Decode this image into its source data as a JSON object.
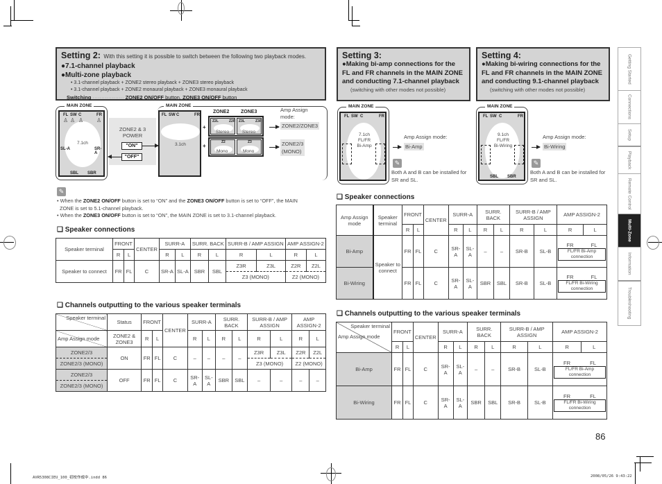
{
  "setting2": {
    "title": "Setting 2:",
    "description": "With this setting it is possible to switch between the following two playback modes.",
    "bullets": [
      "●7.1-channel playback",
      "●Multi-zone playback"
    ],
    "sub_items": [
      "• 3.1-channel playback + ZONE2 stereo playback + ZONE3 stereo playback",
      "• 3.1-channel playback + ZONE2 monaural playback + ZONE3 monaural playback"
    ],
    "switching_label": "Switching",
    "switching_dots": "··················",
    "switching_b1": "ZONE2 ON/OFF",
    "switching_t1": " button, ",
    "switching_b2": "ZONE3 ON/OFF",
    "switching_t2": " button",
    "diagram": {
      "main_zone": "MAIN ZONE",
      "mode_71": "7.1ch",
      "mode_31": "3.1ch",
      "power_label_1": "ZONE2 & 3",
      "power_label_2": "POWER",
      "on_label": "\"ON\"",
      "off_label": "\"OFF\"",
      "zone2": "ZONE2",
      "zone3": "ZONE3",
      "stereo": "Stereo",
      "mono": "Mono",
      "plus": "+",
      "amp_assign_label_1": "Amp Assign",
      "amp_assign_label_2": "mode:",
      "amp_zone23": "ZONE2/ZONE3",
      "amp_zone23_mono_1": "ZONE2/3",
      "amp_zone23_mono_2": "(MONO)",
      "speakers": {
        "fl": "FL",
        "sw": "SW",
        "c": "C",
        "fr": "FR",
        "sla": "SL-A",
        "sra": "SR-A",
        "sbl": "SBL",
        "sbr": "SBR",
        "z2l": "Z2L",
        "z2r": "Z2R",
        "z3l": "Z3L",
        "z3r": "Z3R",
        "z2": "Z2",
        "z3": "Z3"
      }
    },
    "notes": {
      "n1_a": "• When the ",
      "n1_b1": "ZONE2 ON/OFF",
      "n1_c": " button is set to “ON” and the ",
      "n1_b2": "ZONE3 ON/OFF",
      "n1_d": " button is set to “OFF”, the MAIN",
      "n1_e": "ZONE is set to 5.1-channel playback.",
      "n2_a": "• When the ",
      "n2_b": "ZONE3 ON/OFF",
      "n2_c": " button is set to “ON”, the MAIN ZONE is set to 3.1-channel playback."
    },
    "speaker_connections": {
      "title": "❑ Speaker connections",
      "headers": [
        "Speaker terminal",
        "FRONT",
        "CENTER",
        "SURR-A",
        "SURR. BACK",
        "SURR-B / AMP ASSIGN",
        "AMP ASSIGN-2"
      ],
      "rl": [
        "R",
        "L"
      ],
      "row_label": "Speaker to connect",
      "row": [
        "FR",
        "FL",
        "C",
        "SR-A",
        "SL-A",
        "SBR",
        "SBL",
        "Z3R",
        "Z3L",
        "Z2R",
        "Z2L"
      ],
      "mono": [
        "Z3 (MONO)",
        "Z2 (MONO)"
      ]
    },
    "channels": {
      "title": "❑ Channels outputting to the various speaker terminals",
      "corner_top": "Speaker terminal",
      "corner_bottom": "Amp Assign mode",
      "status": "Status",
      "status_sub": "ZONE2 & ZONE3",
      "headers": [
        "FRONT",
        "CENTER",
        "SURR-A",
        "SURR. BACK",
        "SURR-B / AMP ASSIGN",
        "AMP ASSIGN-2"
      ],
      "rows": [
        {
          "modes": [
            "ZONE2/3",
            "ZONE2/3 (MONO)"
          ],
          "status": "ON",
          "front": [
            "FR",
            "FL"
          ],
          "center": "C",
          "surra": [
            "–",
            "–"
          ],
          "surrback": [
            "–",
            "–"
          ],
          "surrb": [
            "Z3R",
            "Z3L"
          ],
          "amp2": [
            "Z2R",
            "Z2L"
          ],
          "mono": [
            "Z3 (MONO)",
            "Z2 (MONO)"
          ]
        },
        {
          "modes": [
            "ZONE2/3",
            "ZONE2/3 (MONO)"
          ],
          "status": "OFF",
          "front": [
            "FR",
            "FL"
          ],
          "center": "C",
          "surra": [
            "SR-A",
            "SL-A"
          ],
          "surrback": [
            "SBR",
            "SBL"
          ],
          "surrb": [
            "–",
            "–"
          ],
          "amp2": [
            "–",
            "–"
          ]
        }
      ]
    }
  },
  "setting3": {
    "title": "Setting 3:",
    "bullet": "●Making bi-amp connections for the FL and FR channels in the MAIN ZONE and conducting 7.1-channel playback",
    "note": "(switching with other modes not possible)",
    "diagram": {
      "main_zone": "MAIN ZONE",
      "mode_1": "7.1ch",
      "mode_2": "FL/FR",
      "mode_3": "Bi-Amp",
      "amp_label": "Amp Assign mode:",
      "amp_value": "Bi-Amp",
      "note": "Both A and B can be installed for SR and SL."
    }
  },
  "setting4": {
    "title": "Setting 4:",
    "bullet": "●Making bi-wiring connections for the FL and FR channels in the MAIN ZONE and conducting 9.1-channel playback",
    "note": "(switching with other modes not possible)",
    "diagram": {
      "main_zone": "MAIN ZONE",
      "mode_1": "9.1ch",
      "mode_2": "FL/FR",
      "mode_3": "Bi-Wiring",
      "amp_label": "Amp Assign mode:",
      "amp_value": "Bi-Wiring",
      "note": "Both A and B can be installed for SR and SL."
    }
  },
  "right_tables": {
    "speaker_connections": {
      "title": "❑ Speaker connections",
      "mode_header": "Amp Assign mode",
      "terminal_header": "Speaker terminal",
      "headers": [
        "FRONT",
        "CENTER",
        "SURR-A",
        "SURR. BACK",
        "SURR-B / AMP ASSIGN",
        "AMP ASSIGN-2"
      ],
      "connect_label": "Speaker to connect",
      "rows": [
        {
          "mode": "Bi-Amp",
          "cells": [
            "FR",
            "FL",
            "C",
            "SR-A",
            "SL-A",
            "–",
            "–",
            "SR-B",
            "SL-B"
          ],
          "amp2": [
            "FR",
            "FL"
          ],
          "amp2_box": "FL/FR Bi-Amp connection"
        },
        {
          "mode": "Bi-Wiring",
          "cells": [
            "FR",
            "FL",
            "C",
            "SR-A",
            "SL-A",
            "SBR",
            "SBL",
            "SR-B",
            "SL-B"
          ],
          "amp2": [
            "FR",
            "FL"
          ],
          "amp2_box": "FL/FR Bi-Wiring connection"
        }
      ]
    },
    "channels": {
      "title": "❑ Channels outputting to the various speaker terminals",
      "corner_top": "Speaker terminal",
      "corner_bottom": "Amp Assign mode"
    }
  },
  "sidebar": {
    "tabs": [
      "Getting Started",
      "Connections",
      "Setup",
      "Playback",
      "Remote Control",
      "Multi-Zone",
      "Information",
      "Troubleshooting"
    ],
    "active": "Multi-Zone"
  },
  "page_number": "86",
  "footer": {
    "file": "AVR5308CIEU_100_初校作成中.indd   86",
    "timestamp": "2008/05/26   9:43:22"
  },
  "colors": {
    "panel_gray": "#d4d4d4",
    "active_tab": "#222222",
    "border": "#333333"
  }
}
